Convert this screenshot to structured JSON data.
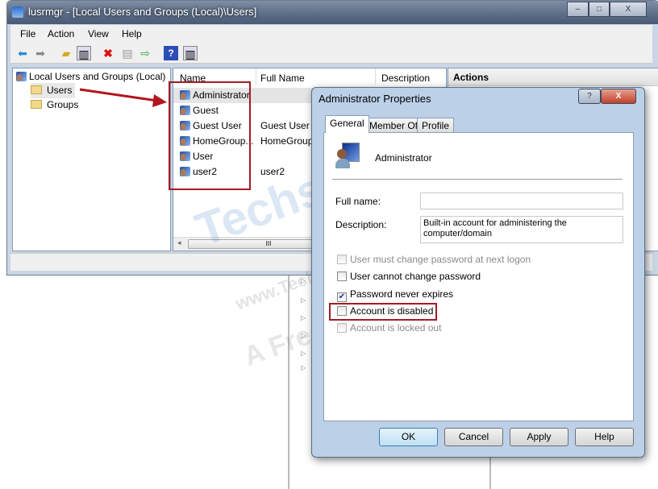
{
  "window": {
    "title": "lusrmgr - [Local Users and Groups (Local)\\Users]",
    "minimize": "–",
    "maximize": "□",
    "close": "X"
  },
  "menu": [
    "File",
    "Action",
    "View",
    "Help"
  ],
  "toolbar": [
    "back-icon",
    "forward-icon",
    "up-folder-icon",
    "show-hide-tree-icon",
    "delete-icon",
    "properties-icon",
    "export-icon",
    "help-icon",
    "show-hide-action-pane-icon"
  ],
  "tree": {
    "root": "Local Users and Groups (Local)",
    "children": [
      "Users",
      "Groups"
    ],
    "selected": "Users"
  },
  "list": {
    "columns": [
      "Name",
      "Full Name",
      "Description"
    ],
    "rows": [
      {
        "name": "Administrator",
        "full": ""
      },
      {
        "name": "Guest",
        "full": ""
      },
      {
        "name": "Guest User",
        "full": "Guest User"
      },
      {
        "name": "HomeGroup...",
        "full": "HomeGroup"
      },
      {
        "name": "User",
        "full": ""
      },
      {
        "name": "user2",
        "full": "user2"
      }
    ],
    "scroll_grip": "III"
  },
  "actions": {
    "header": "Actions"
  },
  "dialog": {
    "title": "Administrator Properties",
    "help": "?",
    "close": "X",
    "tabs": [
      "General",
      "Member Of",
      "Profile"
    ],
    "active_tab": "General",
    "username": "Administrator",
    "full_name_label": "Full name:",
    "full_name_value": "",
    "description_label": "Description:",
    "description_value": "Built-in account for administering the computer/domain",
    "checkboxes": [
      {
        "label": "User must change password at next logon",
        "checked": false,
        "enabled": false
      },
      {
        "label": "User cannot change password",
        "checked": false,
        "enabled": true
      },
      {
        "label": "Password never expires",
        "checked": true,
        "enabled": true
      },
      {
        "label": "Account is disabled",
        "checked": false,
        "enabled": true
      },
      {
        "label": "Account is locked out",
        "checked": false,
        "enabled": false
      }
    ],
    "buttons": {
      "ok": "OK",
      "cancel": "Cancel",
      "apply": "Apply",
      "help": "Help"
    }
  },
  "watermark": {
    "brand": "Techsupport all .com",
    "url": "www.Techsupportall.com",
    "tagline": "A Free Technical Help Center"
  },
  "colors": {
    "highlight": "#a31c24",
    "title_bar": "#5b6c86",
    "dialog_frame": "#bcd0e8"
  }
}
